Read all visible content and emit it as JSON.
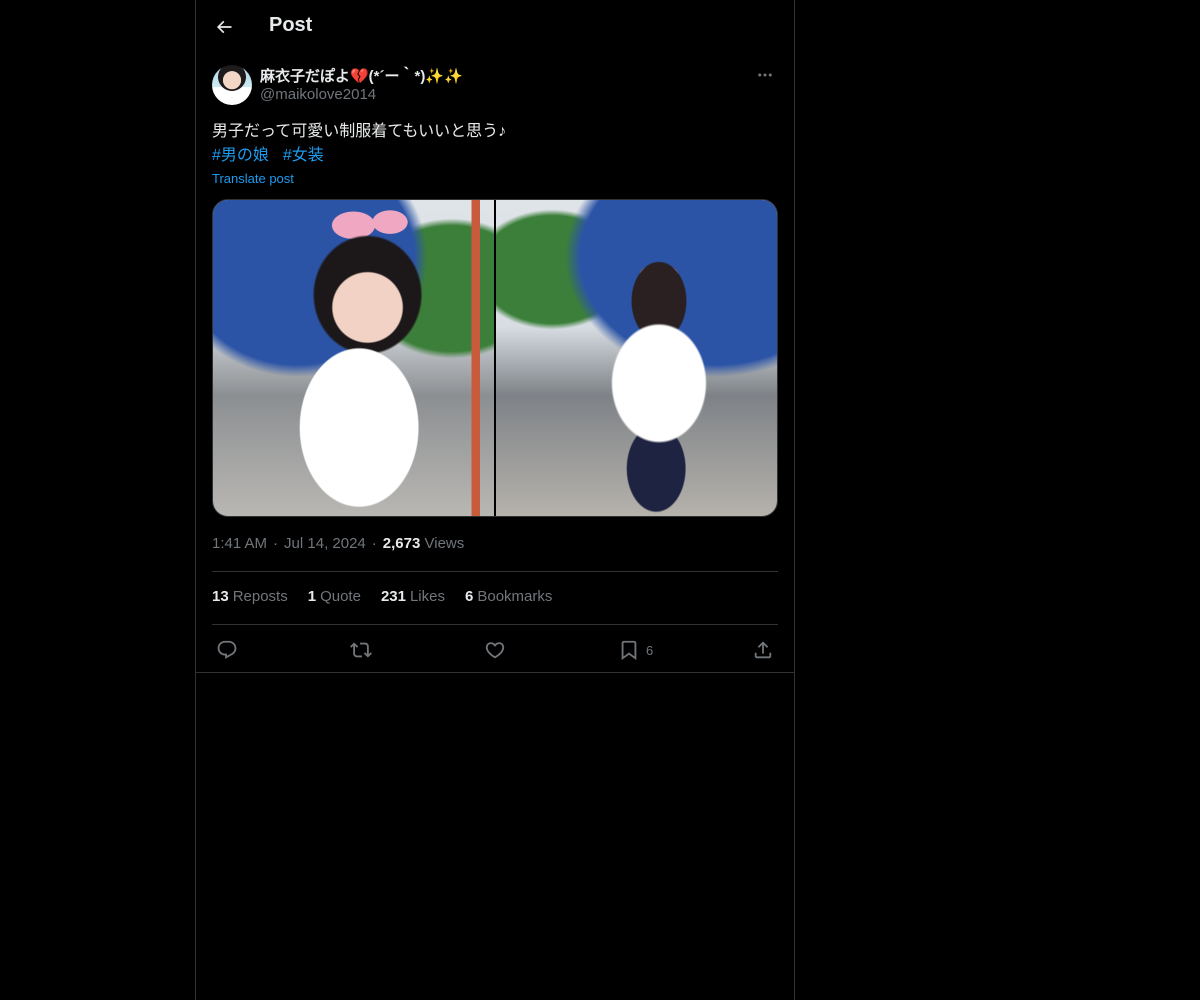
{
  "header": {
    "title": "Post"
  },
  "author": {
    "display_name": "麻衣子だぽよ💔(*´ー｀*)✨✨",
    "handle": "@maikolove2014"
  },
  "post": {
    "text": "男子だって可愛い制服着てもいいと思う♪",
    "hashtags": [
      "#男の娘",
      "#女装"
    ],
    "translate_label": "Translate post"
  },
  "meta": {
    "time": "1:41 AM",
    "date": "Jul 14, 2024",
    "separator": "·",
    "views_count": "2,673",
    "views_label": "Views"
  },
  "stats": {
    "reposts": {
      "count": "13",
      "label": "Reposts"
    },
    "quotes": {
      "count": "1",
      "label": "Quote"
    },
    "likes": {
      "count": "231",
      "label": "Likes"
    },
    "bookmarks": {
      "count": "6",
      "label": "Bookmarks"
    }
  },
  "actions": {
    "bookmark_count": "6",
    "icons": [
      "reply-icon",
      "repost-icon",
      "like-icon",
      "bookmark-icon",
      "share-icon"
    ]
  },
  "colors": {
    "background": "#000000",
    "text": "#e7e9ea",
    "muted": "#71767b",
    "accent": "#1d9bf0",
    "border": "#2f3336"
  }
}
